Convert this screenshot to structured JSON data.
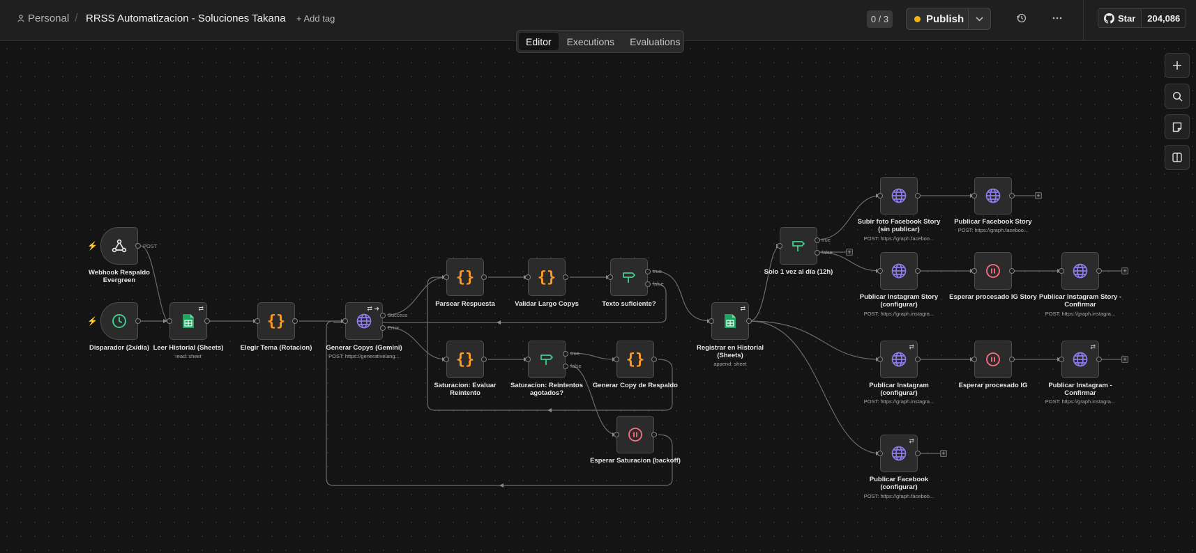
{
  "header": {
    "personal": "Personal",
    "separator": "/",
    "title": "RRSS Automatizacion - Soluciones Takana",
    "add_tag": "+ Add tag",
    "counter": "0 / 3",
    "publish": "Publish",
    "github_star": "Star",
    "github_count": "204,086"
  },
  "tabs": {
    "editor": "Editor",
    "executions": "Executions",
    "evaluations": "Evaluations",
    "active": "Editor"
  },
  "colors": {
    "accent_publish_dot": "#f2b418",
    "code_icon": "#ff9a24",
    "http_icon": "#8c7cf0",
    "if_icon": "#3fcf8e",
    "wait_icon": "#ff6d83",
    "sheets_icon": "#1fa463",
    "schedule_icon": "#3fcf8e",
    "trigger_bolt": "#ff5a4e"
  },
  "nodes": {
    "webhook": {
      "label": "Webhook Respaldo Evergreen",
      "icon": "webhook-icon",
      "output": "POST"
    },
    "schedule": {
      "label": "Disparador (2x/día)",
      "icon": "clock-icon"
    },
    "leer_historial": {
      "label": "Leer Historial (Sheets)",
      "sub": "read: sheet",
      "icon": "google-sheets-icon"
    },
    "elegir_tema": {
      "label": "Elegir Tema (Rotacion)",
      "icon": "code-icon"
    },
    "generar_copys": {
      "label": "Generar Copys (Gemini)",
      "sub": "POST: https://generativelang...",
      "icon": "globe-icon",
      "out_success": "Success",
      "out_error": "Error"
    },
    "parsear": {
      "label": "Parsear Respuesta",
      "icon": "code-icon"
    },
    "validar": {
      "label": "Validar Largo Copys",
      "icon": "code-icon"
    },
    "texto_suficiente": {
      "label": "Texto suficiente?",
      "icon": "if-icon",
      "out_true": "true",
      "out_false": "false"
    },
    "sat_evaluar": {
      "label": "Saturacion: Evaluar Reintento",
      "icon": "code-icon"
    },
    "sat_reintentos": {
      "label": "Saturacion: Reintentos agotados?",
      "icon": "if-icon",
      "out_true": "true",
      "out_false": "false"
    },
    "generar_respaldo": {
      "label": "Generar Copy de Respaldo",
      "icon": "code-icon"
    },
    "esperar_saturacion": {
      "label": "Esperar Saturacion (backoff)",
      "icon": "pause-icon"
    },
    "registrar": {
      "label": "Registrar en Historial (Sheets)",
      "sub": "append: sheet",
      "icon": "google-sheets-icon"
    },
    "solo_1_vez": {
      "label": "Solo 1 vez al día (12h)",
      "icon": "if-icon",
      "out_true": "true",
      "out_false": "false"
    },
    "subir_foto_fb": {
      "label": "Subir foto Facebook Story (sin publicar)",
      "sub": "POST: https://graph.faceboo...",
      "icon": "globe-icon"
    },
    "publicar_fb_story": {
      "label": "Publicar Facebook Story",
      "sub": "POST: https://graph.faceboo...",
      "icon": "globe-icon"
    },
    "publicar_ig_story": {
      "label": "Publicar Instagram Story (configurar)",
      "sub": "POST: https://graph.instagra...",
      "icon": "globe-icon"
    },
    "esperar_ig_story": {
      "label": "Esperar procesado IG Story",
      "icon": "pause-icon"
    },
    "publicar_ig_story_conf": {
      "label": "Publicar Instagram Story - Confirmar",
      "sub": "POST: https://graph.instagra...",
      "icon": "globe-icon"
    },
    "publicar_ig": {
      "label": "Publicar Instagram (configurar)",
      "sub": "POST: https://graph.instagra...",
      "icon": "globe-icon"
    },
    "esperar_ig": {
      "label": "Esperar procesado IG",
      "icon": "pause-icon"
    },
    "publicar_ig_conf": {
      "label": "Publicar Instagram - Confirmar",
      "sub": "POST: https://graph.instagra...",
      "icon": "globe-icon"
    },
    "publicar_fb": {
      "label": "Publicar Facebook (configurar)",
      "sub": "POST: https://graph.faceboo...",
      "icon": "globe-icon"
    }
  },
  "canvas_controls": [
    "zoom-in-icon",
    "search-icon",
    "sticky-note-icon",
    "panel-toggle-icon"
  ]
}
